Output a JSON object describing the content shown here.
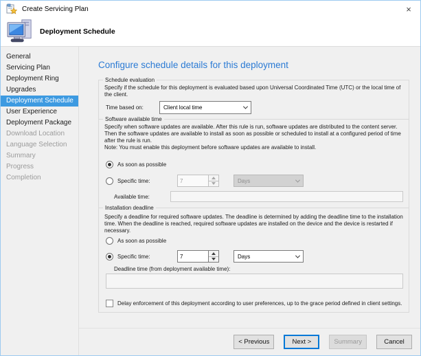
{
  "window": {
    "title": "Create Servicing Plan",
    "close_glyph": "×"
  },
  "header": {
    "title": "Deployment Schedule"
  },
  "sidebar": {
    "items": [
      {
        "label": "General",
        "state": "enabled"
      },
      {
        "label": "Servicing Plan",
        "state": "enabled"
      },
      {
        "label": "Deployment Ring",
        "state": "enabled"
      },
      {
        "label": "Upgrades",
        "state": "enabled"
      },
      {
        "label": "Deployment Schedule",
        "state": "selected"
      },
      {
        "label": "User Experience",
        "state": "enabled"
      },
      {
        "label": "Deployment Package",
        "state": "enabled"
      },
      {
        "label": "Download Location",
        "state": "disabled"
      },
      {
        "label": "Language Selection",
        "state": "disabled"
      },
      {
        "label": "Summary",
        "state": "disabled"
      },
      {
        "label": "Progress",
        "state": "disabled"
      },
      {
        "label": "Completion",
        "state": "disabled"
      }
    ]
  },
  "main": {
    "heading": "Configure schedule details for this deployment",
    "schedule_evaluation": {
      "title": "Schedule evaluation",
      "description": "Specify if the schedule for this deployment is evaluated based upon Universal Coordinated Time (UTC) or the local time of the client.",
      "time_based_on_label": "Time based on:",
      "time_based_on_value": "Client local time"
    },
    "software_available_time": {
      "title": "Software available time",
      "description": "Specify when software updates are available. After this rule is run, software updates are distributed to the content server. Then the software updates are available to install as soon as possible or scheduled to install at a configured period of time after the rule is run.",
      "note": "Note: You must enable this deployment before software updates are available to install.",
      "asap_label": "As soon as possible",
      "asap_selected": true,
      "specific_time_label": "Specific time:",
      "specific_selected": false,
      "specific_value": "7",
      "specific_unit": "Days",
      "available_time_label": "Available time:",
      "available_time_value": ""
    },
    "installation_deadline": {
      "title": "Installation deadline",
      "description": "Specify a deadline for required software updates. The deadline is determined by adding the deadline time to the installation time. When the deadline is reached, required software updates are installed on the device and the device is restarted if necessary.",
      "asap_label": "As soon as possible",
      "asap_selected": false,
      "specific_time_label": "Specific time:",
      "specific_selected": true,
      "specific_value": "7",
      "specific_unit": "Days",
      "deadline_time_label": "Deadline time (from deployment available time):",
      "deadline_time_value": "",
      "delay_checkbox_label": "Delay enforcement of this deployment according to user preferences, up to the grace period defined in client settings.",
      "delay_checkbox_checked": false
    }
  },
  "footer": {
    "previous_label": "< Previous",
    "next_label": "Next >",
    "summary_label": "Summary",
    "cancel_label": "Cancel"
  },
  "colors": {
    "window_border": "#9ccaf0",
    "nav_selected_bg": "#3d9ae1",
    "heading_blue": "#2a7ad4",
    "default_button_border": "#0078d7",
    "monitor_screen_blue": "#3c87e0"
  }
}
